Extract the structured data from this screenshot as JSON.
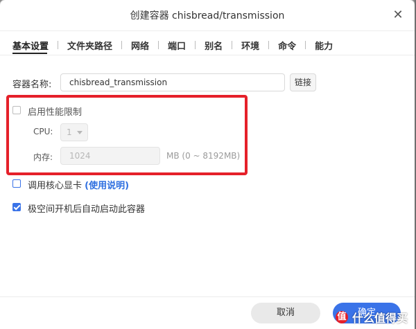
{
  "dialog": {
    "title": "创建容器 chisbread/transmission",
    "close_glyph": "✕"
  },
  "tabs": [
    {
      "label": "基本设置",
      "active": true
    },
    {
      "label": "文件夹路径"
    },
    {
      "label": "网络"
    },
    {
      "label": "端口"
    },
    {
      "label": "别名"
    },
    {
      "label": "环境"
    },
    {
      "label": "命令"
    },
    {
      "label": "能力"
    }
  ],
  "form": {
    "container_name_label": "容器名称:",
    "container_name_value": "chisbread_transmission",
    "link_button": "链接",
    "perf_limit_label": "启用性能限制",
    "cpu_label": "CPU:",
    "cpu_value": "1",
    "memory_label": "内存:",
    "memory_value": "1024",
    "memory_unit": "MB (0 ~ 8192MB)",
    "gpu_label": "调用核心显卡",
    "gpu_help_link": "(使用说明)",
    "autostart_label": "极空间开机后自动启动此容器"
  },
  "footer": {
    "cancel": "取消",
    "confirm": "确定"
  },
  "watermark": {
    "badge": "值",
    "text": "什么值得买"
  },
  "colors": {
    "accent": "#3a73e8",
    "highlight_box": "#e5202a"
  }
}
